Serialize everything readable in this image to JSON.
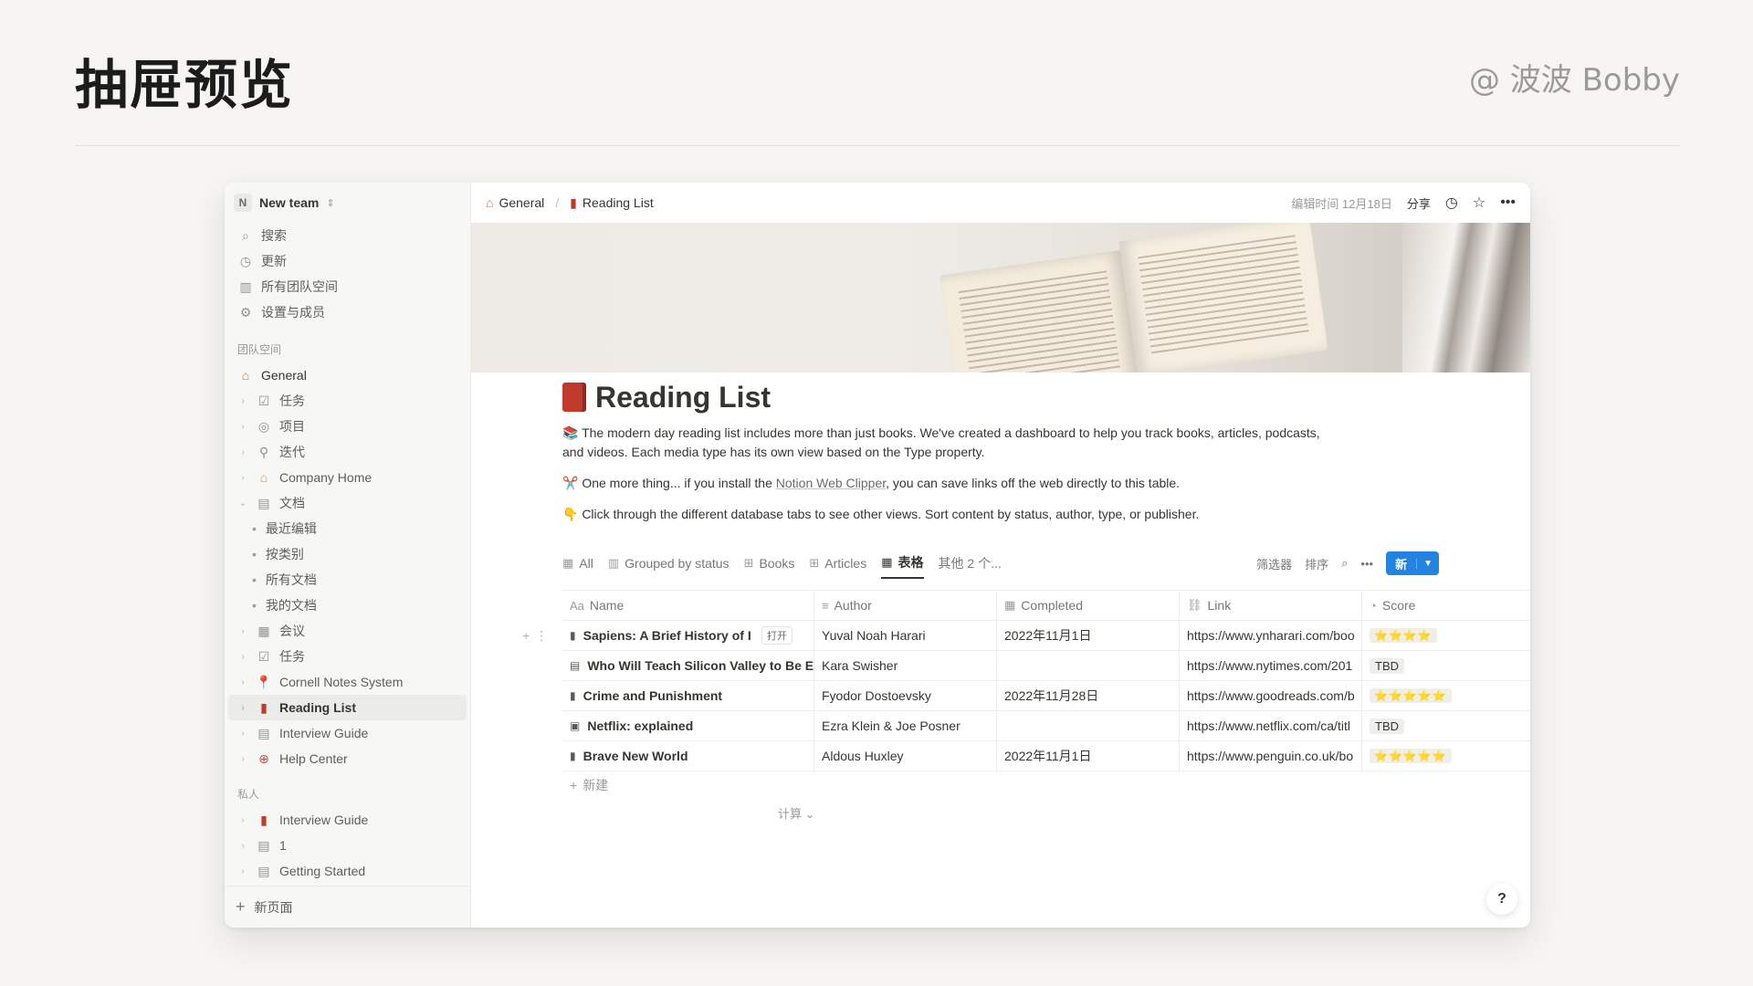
{
  "slide": {
    "title": "抽屉预览",
    "author": "@ 波波 Bobby"
  },
  "sidebar": {
    "team_badge": "N",
    "team_name": "New team",
    "top_items": [
      {
        "icon": "search-icon",
        "label": "搜索"
      },
      {
        "icon": "clock-icon",
        "label": "更新"
      },
      {
        "icon": "grid-icon",
        "label": "所有团队空间"
      },
      {
        "icon": "gear-icon",
        "label": "设置与成员"
      }
    ],
    "section_team": "团队空间",
    "team_items": [
      {
        "label": "General",
        "icon": "house-icon"
      },
      {
        "label": "任务",
        "icon": "checkbox-icon"
      },
      {
        "label": "项目",
        "icon": "target-icon"
      },
      {
        "label": "迭代",
        "icon": "runner-icon"
      },
      {
        "label": "Company Home",
        "icon": "home-emoji-icon"
      },
      {
        "label": "文档",
        "icon": "doc-icon"
      }
    ],
    "doc_subitems": [
      "最近编辑",
      "按类别",
      "所有文档",
      "我的文档"
    ],
    "team_items_2": [
      {
        "label": "会议",
        "icon": "calendar-icon"
      },
      {
        "label": "任务",
        "icon": "checkbox-icon"
      },
      {
        "label": "Cornell Notes System",
        "icon": "pin-icon"
      },
      {
        "label": "Reading List",
        "icon": "book-icon"
      },
      {
        "label": "Interview Guide",
        "icon": "doc-icon"
      },
      {
        "label": "Help Center",
        "icon": "lifebuoy-icon"
      }
    ],
    "section_private": "私人",
    "private_items": [
      {
        "label": "Interview Guide",
        "icon": "book-icon"
      },
      {
        "label": "1",
        "icon": "doc-icon"
      },
      {
        "label": "Getting Started",
        "icon": "doc-icon"
      }
    ],
    "new_page": "新页面"
  },
  "topbar": {
    "crumb_1": "General",
    "crumb_sep": "/",
    "crumb_2": "Reading List",
    "edited": "编辑时间 12月18日",
    "share": "分享"
  },
  "page": {
    "title": "Reading List",
    "para1": "📚 The modern day reading list includes more than just books. We've created a dashboard to help you track books, articles, podcasts, and videos. Each media type has its own view based on the Type property.",
    "para2_pre": "✂️ One more thing... if you install the ",
    "para2_link": "Notion Web Clipper",
    "para2_post": ", you can save links off the web directly to this table.",
    "para3": "👇 Click through the different database tabs to see other views. Sort content by status, author, type, or publisher."
  },
  "tabs": [
    {
      "icon": "table-icon",
      "label": "All"
    },
    {
      "icon": "board-icon",
      "label": "Grouped by status"
    },
    {
      "icon": "gallery-icon",
      "label": "Books"
    },
    {
      "icon": "gallery-icon",
      "label": "Articles"
    },
    {
      "icon": "table-icon",
      "label": "表格"
    },
    {
      "icon": "",
      "label": "其他 2 个..."
    }
  ],
  "tools": {
    "filter": "筛选器",
    "sort": "排序",
    "new": "新"
  },
  "table": {
    "headers": [
      {
        "icon": "Aa",
        "label": "Name"
      },
      {
        "icon": "≡",
        "label": "Author"
      },
      {
        "icon": "▦",
        "label": "Completed"
      },
      {
        "icon": "⛓",
        "label": "Link"
      },
      {
        "icon": "◔",
        "label": "Score"
      }
    ],
    "rows": [
      {
        "name": "Sapiens: A Brief History of I",
        "author": "Yuval Noah Harari",
        "completed": "2022年11月1日",
        "link": "https://www.ynharari.com/boo",
        "score": "⭐⭐⭐⭐",
        "score_type": "stars"
      },
      {
        "name": "Who Will Teach Silicon Valley to Be Et",
        "author": "Kara Swisher",
        "completed": "",
        "link": "https://www.nytimes.com/201",
        "score": "TBD",
        "score_type": "tbd"
      },
      {
        "name": "Crime and Punishment",
        "author": "Fyodor Dostoevsky",
        "completed": "2022年11月28日",
        "link": "https://www.goodreads.com/b",
        "score": "⭐⭐⭐⭐⭐",
        "score_type": "stars"
      },
      {
        "name": "Netflix: explained",
        "author": "Ezra Klein & Joe Posner",
        "completed": "",
        "link": "https://www.netflix.com/ca/titl",
        "score": "TBD",
        "score_type": "tbd"
      },
      {
        "name": "Brave New World",
        "author": "Aldous Huxley",
        "completed": "2022年11月1日",
        "link": "https://www.penguin.co.uk/bo",
        "score": "⭐⭐⭐⭐⭐",
        "score_type": "stars"
      }
    ],
    "open_chip": "打开",
    "new_row": "新建",
    "calc": "计算 ⌄"
  },
  "help": "?"
}
